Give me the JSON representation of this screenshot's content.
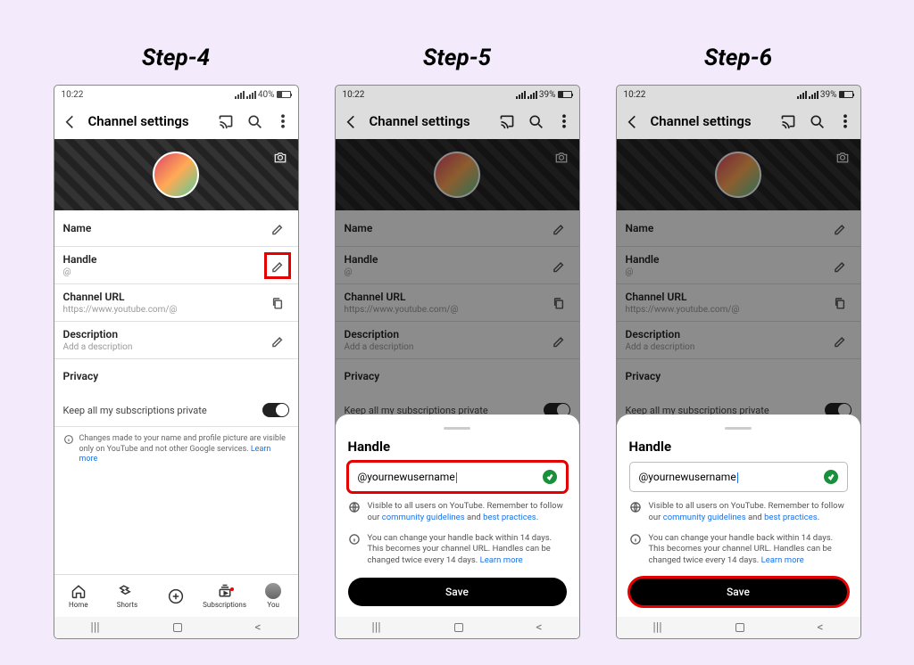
{
  "steps": {
    "s4": "Step-4",
    "s5": "Step-5",
    "s6": "Step-6"
  },
  "status": {
    "time": "10:22",
    "battery4": "40%",
    "battery5": "39%",
    "battery6": "39%"
  },
  "header": {
    "title": "Channel settings"
  },
  "rows": {
    "name": "Name",
    "handle": "Handle",
    "handleVal": "@",
    "url": "Channel URL",
    "urlVal": "https://www.youtube.com/@",
    "desc": "Description",
    "descVal": "Add a description",
    "privacy": "Privacy",
    "privacyVal": "Keep all my subscriptions private"
  },
  "note": {
    "text": "Changes made to your name and profile picture are visible only on YouTube and not other Google services. ",
    "link": "Learn more"
  },
  "nav": {
    "home": "Home",
    "shorts": "Shorts",
    "subs": "Subscriptions",
    "you": "You"
  },
  "sheet": {
    "title": "Handle",
    "value": "@yournewusername",
    "info1a": "Visible to all users on YouTube. Remember to follow our ",
    "info1link1": "community guidelines",
    "info1mid": " and ",
    "info1link2": "best practices",
    "info1end": ".",
    "info2a": "You can change your handle back within 14 days. This becomes your channel URL. Handles can be changed twice every 14 days. ",
    "info2link": "Learn more",
    "save": "Save"
  }
}
